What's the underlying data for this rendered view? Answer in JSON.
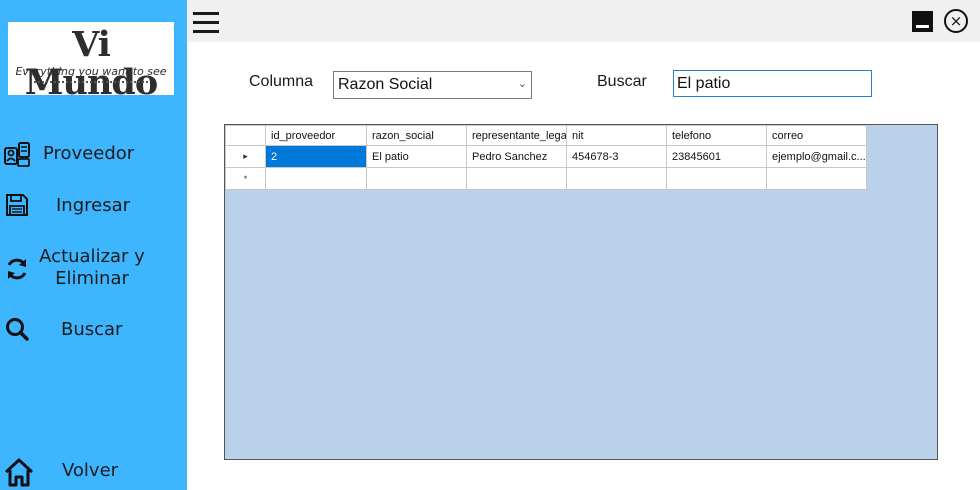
{
  "logo": {
    "title": "Vi Mundo",
    "subtitle": "Everything you want to see"
  },
  "sidebar": {
    "items": [
      {
        "label": "Proveedor",
        "icon": "supplier-icon"
      },
      {
        "label": "Ingresar",
        "icon": "save-icon"
      },
      {
        "label_line1": "Actualizar y",
        "label_line2": "Eliminar",
        "icon": "refresh-icon"
      },
      {
        "label": "Buscar",
        "icon": "search-icon"
      },
      {
        "label": "Volver",
        "icon": "home-icon"
      }
    ]
  },
  "window": {
    "close_glyph": "×"
  },
  "filters": {
    "column_label": "Columna",
    "column_value": "Razon Social",
    "search_label": "Buscar",
    "search_value": "El patio"
  },
  "grid": {
    "columns": [
      "id_proveedor",
      "razon_social",
      "representante_lega",
      "nit",
      "telefono",
      "correo"
    ],
    "rows": [
      [
        "2",
        "El patio",
        "Pedro Sanchez",
        "454678-3",
        "23845601",
        "ejemplo@gmail.c..."
      ]
    ],
    "current_row_marker": "▸",
    "new_row_marker": "*"
  },
  "colors": {
    "sidebar": "#3db5ff",
    "grid_background": "#b9d1ea",
    "selection": "#0078d7"
  }
}
